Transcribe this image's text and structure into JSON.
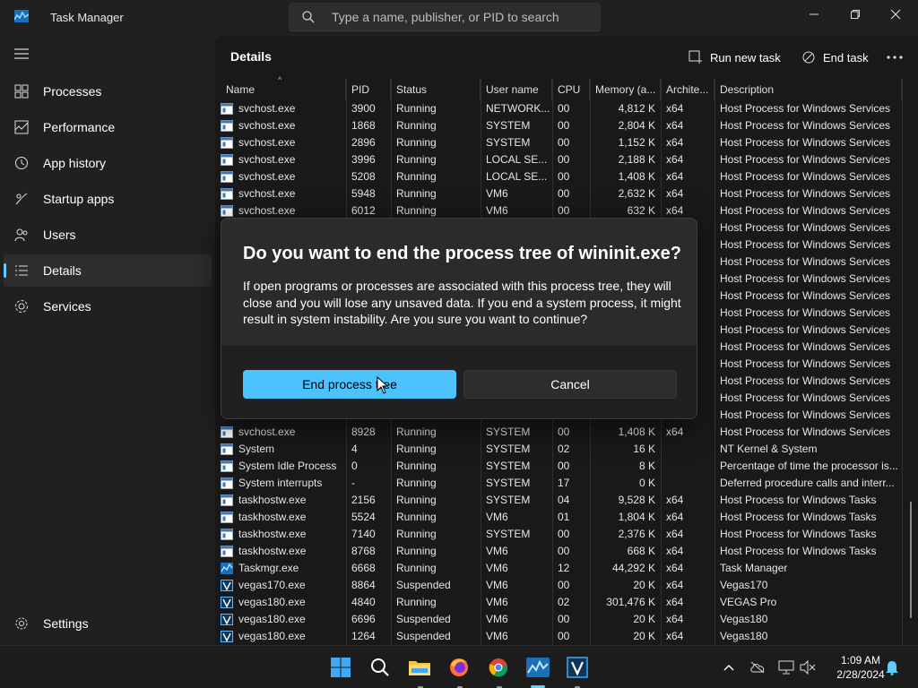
{
  "window": {
    "title": "Task Manager",
    "search_placeholder": "Type a name, publisher, or PID to search"
  },
  "sidebar": {
    "items": [
      {
        "label": "Processes",
        "icon": "processes-icon"
      },
      {
        "label": "Performance",
        "icon": "performance-icon"
      },
      {
        "label": "App history",
        "icon": "app-history-icon"
      },
      {
        "label": "Startup apps",
        "icon": "startup-apps-icon"
      },
      {
        "label": "Users",
        "icon": "users-icon"
      },
      {
        "label": "Details",
        "icon": "details-icon",
        "active": true
      },
      {
        "label": "Services",
        "icon": "services-icon"
      }
    ],
    "settings_label": "Settings"
  },
  "header": {
    "title": "Details",
    "run_new_task": "Run new task",
    "end_task": "End task"
  },
  "table": {
    "columns": [
      "Name",
      "PID",
      "Status",
      "User name",
      "CPU",
      "Memory (a...",
      "Archite...",
      "Description"
    ],
    "rows": [
      {
        "name": "svchost.exe",
        "pid": "3900",
        "status": "Running",
        "user": "NETWORK...",
        "cpu": "00",
        "mem": "4,812 K",
        "arch": "x64",
        "desc": "Host Process for Windows Services",
        "icon": "svc"
      },
      {
        "name": "svchost.exe",
        "pid": "1868",
        "status": "Running",
        "user": "SYSTEM",
        "cpu": "00",
        "mem": "2,804 K",
        "arch": "x64",
        "desc": "Host Process for Windows Services",
        "icon": "svc"
      },
      {
        "name": "svchost.exe",
        "pid": "2896",
        "status": "Running",
        "user": "SYSTEM",
        "cpu": "00",
        "mem": "1,152 K",
        "arch": "x64",
        "desc": "Host Process for Windows Services",
        "icon": "svc"
      },
      {
        "name": "svchost.exe",
        "pid": "3996",
        "status": "Running",
        "user": "LOCAL SE...",
        "cpu": "00",
        "mem": "2,188 K",
        "arch": "x64",
        "desc": "Host Process for Windows Services",
        "icon": "svc"
      },
      {
        "name": "svchost.exe",
        "pid": "5208",
        "status": "Running",
        "user": "LOCAL SE...",
        "cpu": "00",
        "mem": "1,408 K",
        "arch": "x64",
        "desc": "Host Process for Windows Services",
        "icon": "svc"
      },
      {
        "name": "svchost.exe",
        "pid": "5948",
        "status": "Running",
        "user": "VM6",
        "cpu": "00",
        "mem": "2,632 K",
        "arch": "x64",
        "desc": "Host Process for Windows Services",
        "icon": "svc"
      },
      {
        "name": "svchost.exe",
        "pid": "6012",
        "status": "Running",
        "user": "VM6",
        "cpu": "00",
        "mem": "632 K",
        "arch": "x64",
        "desc": "Host Process for Windows Services",
        "icon": "svc"
      },
      {
        "name": "",
        "pid": "",
        "status": "",
        "user": "",
        "cpu": "",
        "mem": "",
        "arch": "",
        "desc": "Host Process for Windows Services",
        "icon": ""
      },
      {
        "name": "",
        "pid": "",
        "status": "",
        "user": "",
        "cpu": "",
        "mem": "",
        "arch": "",
        "desc": "Host Process for Windows Services",
        "icon": ""
      },
      {
        "name": "",
        "pid": "",
        "status": "",
        "user": "",
        "cpu": "",
        "mem": "",
        "arch": "",
        "desc": "Host Process for Windows Services",
        "icon": ""
      },
      {
        "name": "",
        "pid": "",
        "status": "",
        "user": "",
        "cpu": "",
        "mem": "",
        "arch": "",
        "desc": "Host Process for Windows Services",
        "icon": ""
      },
      {
        "name": "",
        "pid": "",
        "status": "",
        "user": "",
        "cpu": "",
        "mem": "",
        "arch": "",
        "desc": "Host Process for Windows Services",
        "icon": ""
      },
      {
        "name": "",
        "pid": "",
        "status": "",
        "user": "",
        "cpu": "",
        "mem": "",
        "arch": "",
        "desc": "Host Process for Windows Services",
        "icon": ""
      },
      {
        "name": "",
        "pid": "",
        "status": "",
        "user": "",
        "cpu": "",
        "mem": "",
        "arch": "",
        "desc": "Host Process for Windows Services",
        "icon": ""
      },
      {
        "name": "",
        "pid": "",
        "status": "",
        "user": "",
        "cpu": "",
        "mem": "",
        "arch": "",
        "desc": "Host Process for Windows Services",
        "icon": ""
      },
      {
        "name": "",
        "pid": "",
        "status": "",
        "user": "",
        "cpu": "",
        "mem": "",
        "arch": "",
        "desc": "Host Process for Windows Services",
        "icon": ""
      },
      {
        "name": "",
        "pid": "",
        "status": "",
        "user": "",
        "cpu": "",
        "mem": "",
        "arch": "",
        "desc": "Host Process for Windows Services",
        "icon": ""
      },
      {
        "name": "",
        "pid": "",
        "status": "",
        "user": "",
        "cpu": "",
        "mem": "",
        "arch": "",
        "desc": "Host Process for Windows Services",
        "icon": ""
      },
      {
        "name": "",
        "pid": "",
        "status": "",
        "user": "",
        "cpu": "",
        "mem": "",
        "arch": "",
        "desc": "Host Process for Windows Services",
        "icon": ""
      },
      {
        "name": "svchost.exe",
        "pid": "8928",
        "status": "Running",
        "user": "SYSTEM",
        "cpu": "00",
        "mem": "1,408 K",
        "arch": "x64",
        "desc": "Host Process for Windows Services",
        "icon": "svc"
      },
      {
        "name": "System",
        "pid": "4",
        "status": "Running",
        "user": "SYSTEM",
        "cpu": "02",
        "mem": "16 K",
        "arch": "",
        "desc": "NT Kernel & System",
        "icon": "svc"
      },
      {
        "name": "System Idle Process",
        "pid": "0",
        "status": "Running",
        "user": "SYSTEM",
        "cpu": "00",
        "mem": "8 K",
        "arch": "",
        "desc": "Percentage of time the processor is...",
        "icon": "svc"
      },
      {
        "name": "System interrupts",
        "pid": "-",
        "status": "Running",
        "user": "SYSTEM",
        "cpu": "17",
        "mem": "0 K",
        "arch": "",
        "desc": "Deferred procedure calls and interr...",
        "icon": "svc"
      },
      {
        "name": "taskhostw.exe",
        "pid": "2156",
        "status": "Running",
        "user": "SYSTEM",
        "cpu": "04",
        "mem": "9,528 K",
        "arch": "x64",
        "desc": "Host Process for Windows Tasks",
        "icon": "svc"
      },
      {
        "name": "taskhostw.exe",
        "pid": "5524",
        "status": "Running",
        "user": "VM6",
        "cpu": "01",
        "mem": "1,804 K",
        "arch": "x64",
        "desc": "Host Process for Windows Tasks",
        "icon": "svc"
      },
      {
        "name": "taskhostw.exe",
        "pid": "7140",
        "status": "Running",
        "user": "SYSTEM",
        "cpu": "00",
        "mem": "2,376 K",
        "arch": "x64",
        "desc": "Host Process for Windows Tasks",
        "icon": "svc"
      },
      {
        "name": "taskhostw.exe",
        "pid": "8768",
        "status": "Running",
        "user": "VM6",
        "cpu": "00",
        "mem": "668 K",
        "arch": "x64",
        "desc": "Host Process for Windows Tasks",
        "icon": "svc"
      },
      {
        "name": "Taskmgr.exe",
        "pid": "6668",
        "status": "Running",
        "user": "VM6",
        "cpu": "12",
        "mem": "44,292 K",
        "arch": "x64",
        "desc": "Task Manager",
        "icon": "tm"
      },
      {
        "name": "vegas170.exe",
        "pid": "8864",
        "status": "Suspended",
        "user": "VM6",
        "cpu": "00",
        "mem": "20 K",
        "arch": "x64",
        "desc": "Vegas170",
        "icon": "v"
      },
      {
        "name": "vegas180.exe",
        "pid": "4840",
        "status": "Running",
        "user": "VM6",
        "cpu": "02",
        "mem": "301,476 K",
        "arch": "x64",
        "desc": "VEGAS Pro",
        "icon": "v"
      },
      {
        "name": "vegas180.exe",
        "pid": "6696",
        "status": "Suspended",
        "user": "VM6",
        "cpu": "00",
        "mem": "20 K",
        "arch": "x64",
        "desc": "Vegas180",
        "icon": "v"
      },
      {
        "name": "vegas180.exe",
        "pid": "1264",
        "status": "Suspended",
        "user": "VM6",
        "cpu": "00",
        "mem": "20 K",
        "arch": "x64",
        "desc": "Vegas180",
        "icon": "v"
      }
    ]
  },
  "dialog": {
    "title": "Do you want to end the process tree of wininit.exe?",
    "message": "If open programs or processes are associated with this process tree, they will close and you will lose any unsaved data. If you end a system process, it might result in system instability. Are you sure you want to continue?",
    "confirm_label": "End process tree",
    "cancel_label": "Cancel"
  },
  "taskbar": {
    "apps": [
      "start-icon",
      "search-icon",
      "file-explorer-icon",
      "firefox-icon",
      "chrome-icon",
      "task-manager-icon",
      "vegas-icon"
    ],
    "time": "1:09 AM",
    "date": "2/28/2024"
  },
  "colors": {
    "accent": "#4cc2ff",
    "background": "#202020",
    "content_background": "#191919"
  }
}
